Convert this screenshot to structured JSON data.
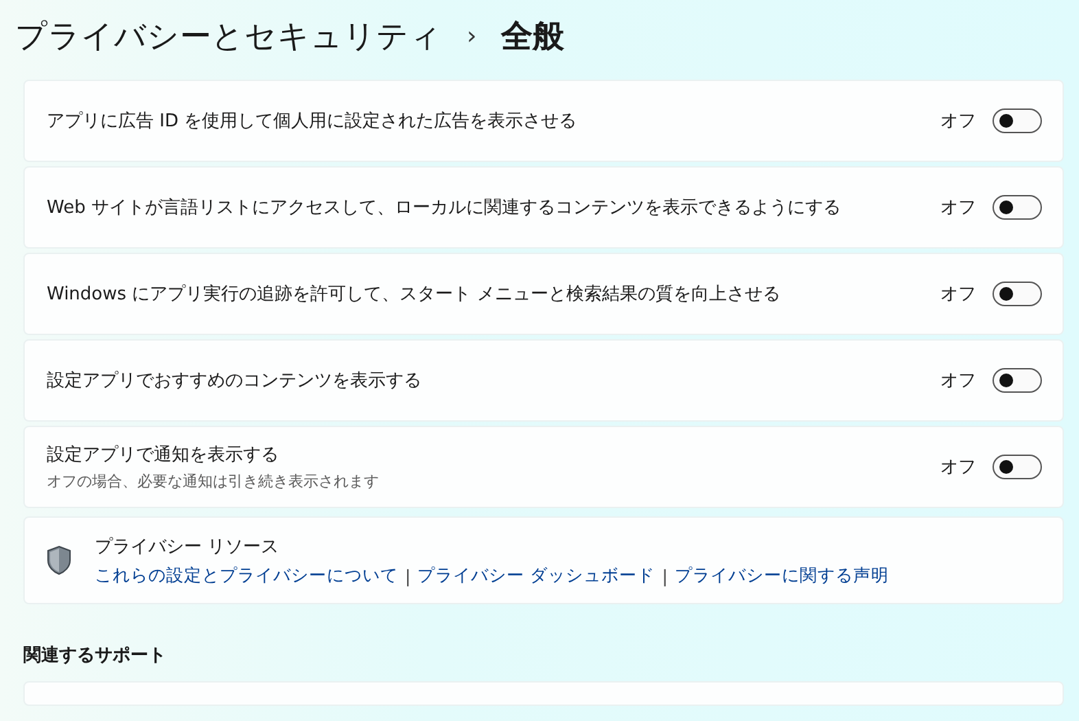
{
  "header": {
    "breadcrumb_parent": "プライバシーとセキュリティ",
    "separator": "›",
    "title": "全般"
  },
  "settings": [
    {
      "label": "アプリに広告 ID を使用して個人用に設定された広告を表示させる",
      "state_label": "オフ",
      "on": false
    },
    {
      "label": "Web サイトが言語リストにアクセスして、ローカルに関連するコンテンツを表示できるようにする",
      "state_label": "オフ",
      "on": false
    },
    {
      "label": "Windows にアプリ実行の追跡を許可して、スタート メニューと検索結果の質を向上させる",
      "state_label": "オフ",
      "on": false
    },
    {
      "label": "設定アプリでおすすめのコンテンツを表示する",
      "state_label": "オフ",
      "on": false
    },
    {
      "label": "設定アプリで通知を表示する",
      "description": "オフの場合、必要な通知は引き続き表示されます",
      "state_label": "オフ",
      "on": false
    }
  ],
  "privacy_resources": {
    "title": "プライバシー リソース",
    "separator": "|",
    "links": [
      "これらの設定とプライバシーについて",
      "プライバシー ダッシュボード",
      "プライバシーに関する声明"
    ]
  },
  "related_support": {
    "heading": "関連するサポート"
  }
}
